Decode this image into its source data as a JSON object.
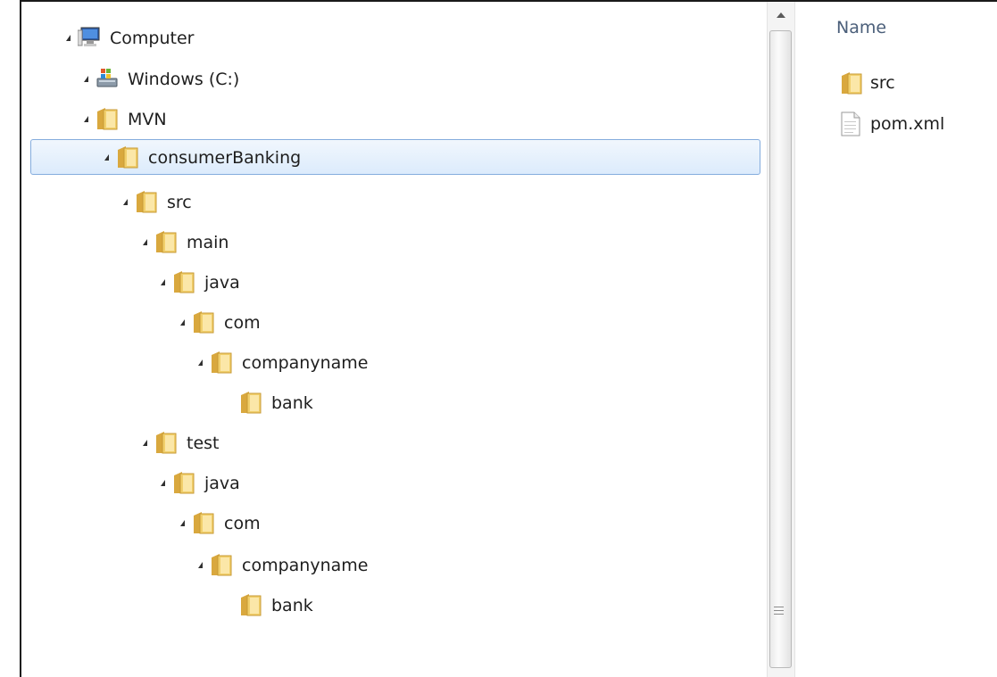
{
  "tree": {
    "items": [
      {
        "label": "Computer",
        "icon": "computer-icon"
      },
      {
        "label": "Windows (C:)",
        "icon": "drive-icon"
      },
      {
        "label": "MVN",
        "icon": "folder-icon"
      },
      {
        "label": "consumerBanking",
        "icon": "folder-icon",
        "selected": true
      },
      {
        "label": "src",
        "icon": "folder-icon"
      },
      {
        "label": "main",
        "icon": "folder-icon"
      },
      {
        "label": "java",
        "icon": "folder-icon"
      },
      {
        "label": "com",
        "icon": "folder-icon"
      },
      {
        "label": "companyname",
        "icon": "folder-icon"
      },
      {
        "label": "bank",
        "icon": "folder-icon"
      },
      {
        "label": "test",
        "icon": "folder-icon"
      },
      {
        "label": "java",
        "icon": "folder-icon"
      },
      {
        "label": "com",
        "icon": "folder-icon"
      },
      {
        "label": "companyname",
        "icon": "folder-icon"
      },
      {
        "label": "bank",
        "icon": "folder-icon"
      }
    ]
  },
  "details": {
    "column_header": "Name",
    "files": [
      {
        "name": "src",
        "icon": "folder-icon"
      },
      {
        "name": "pom.xml",
        "icon": "document-icon"
      }
    ]
  },
  "colors": {
    "selection_border": "#84acdd",
    "selection_fill": "#dcebfc",
    "folder": "#e9c25a"
  }
}
